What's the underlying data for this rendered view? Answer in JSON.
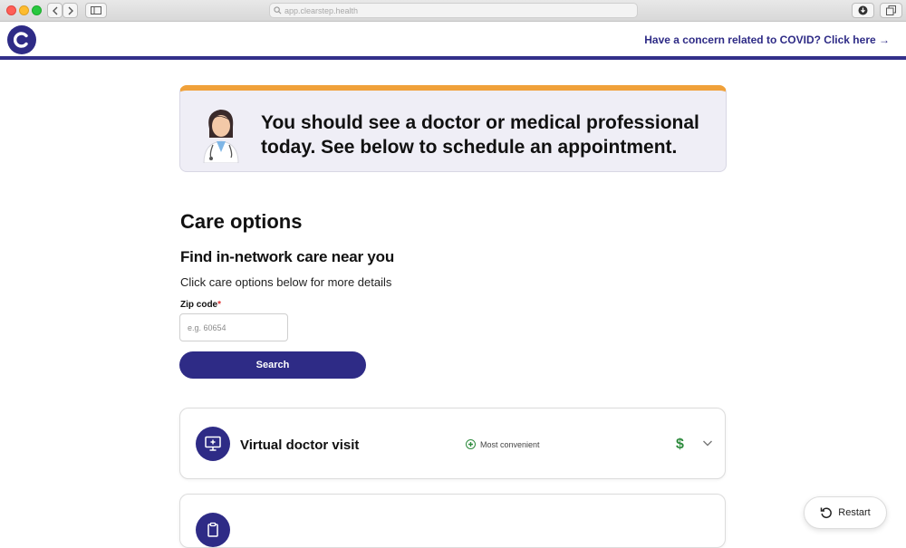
{
  "browser": {
    "url": "app.clearstep.health"
  },
  "header": {
    "covid_link": "Have a concern related to COVID? Click here →"
  },
  "banner": {
    "message": "You should see a doctor or medical professional today. See below to schedule an appointment."
  },
  "care": {
    "title": "Care options",
    "find_title": "Find in-network care near you",
    "instructions": "Click care options below for more details",
    "zip_label": "Zip code",
    "zip_required": "*",
    "zip_placeholder": "e.g. 60654",
    "search_label": "Search"
  },
  "options": [
    {
      "title": "Virtual doctor visit",
      "badge": "Most convenient",
      "cost": "$"
    }
  ],
  "restart_label": "Restart",
  "colors": {
    "brand": "#2e2b86",
    "accent": "#f0a13a",
    "success": "#2e8b3e"
  }
}
